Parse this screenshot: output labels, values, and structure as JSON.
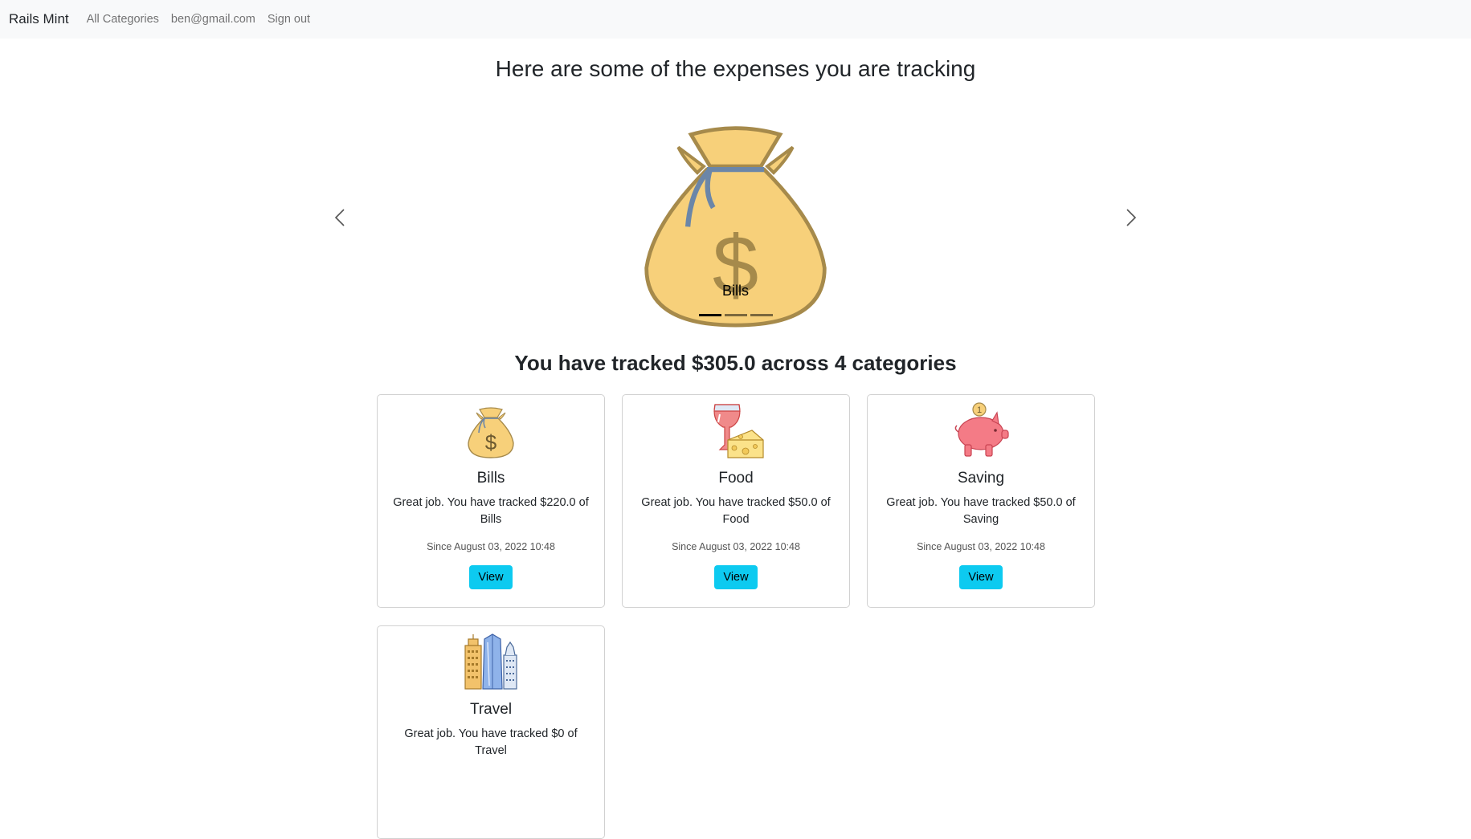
{
  "navbar": {
    "brand": "Rails Mint",
    "links": [
      "All Categories",
      "ben@gmail.com",
      "Sign out"
    ]
  },
  "headline": "Here are some of the expenses you are tracking",
  "carousel": {
    "caption": "Bills",
    "image_icon": "money-bag-icon",
    "slides_count": 3,
    "active_slide": 0
  },
  "summary": "You have tracked $305.0 across 4 categories",
  "categories": [
    {
      "name": "Bills",
      "icon": "money-bag-icon",
      "text": "Great job. You have tracked $220.0 of Bills",
      "since": "Since August 03, 2022 10:48",
      "button": "View"
    },
    {
      "name": "Food",
      "icon": "wine-and-cheese-icon",
      "text": "Great job. You have tracked $50.0 of Food",
      "since": "Since August 03, 2022 10:48",
      "button": "View"
    },
    {
      "name": "Saving",
      "icon": "piggy-bank-icon",
      "text": "Great job. You have tracked $50.0 of Saving",
      "since": "Since August 03, 2022 10:48",
      "button": "View"
    },
    {
      "name": "Travel",
      "icon": "city-buildings-icon",
      "text": "Great job. You have tracked $0 of Travel",
      "since": "",
      "button": ""
    }
  ],
  "colors": {
    "navbar_bg": "#f8f9fa",
    "button_bg": "#0dcaf0",
    "bag": "#f7d07a",
    "bag_outline": "#a68a4b",
    "tie": "#6b86a8"
  }
}
